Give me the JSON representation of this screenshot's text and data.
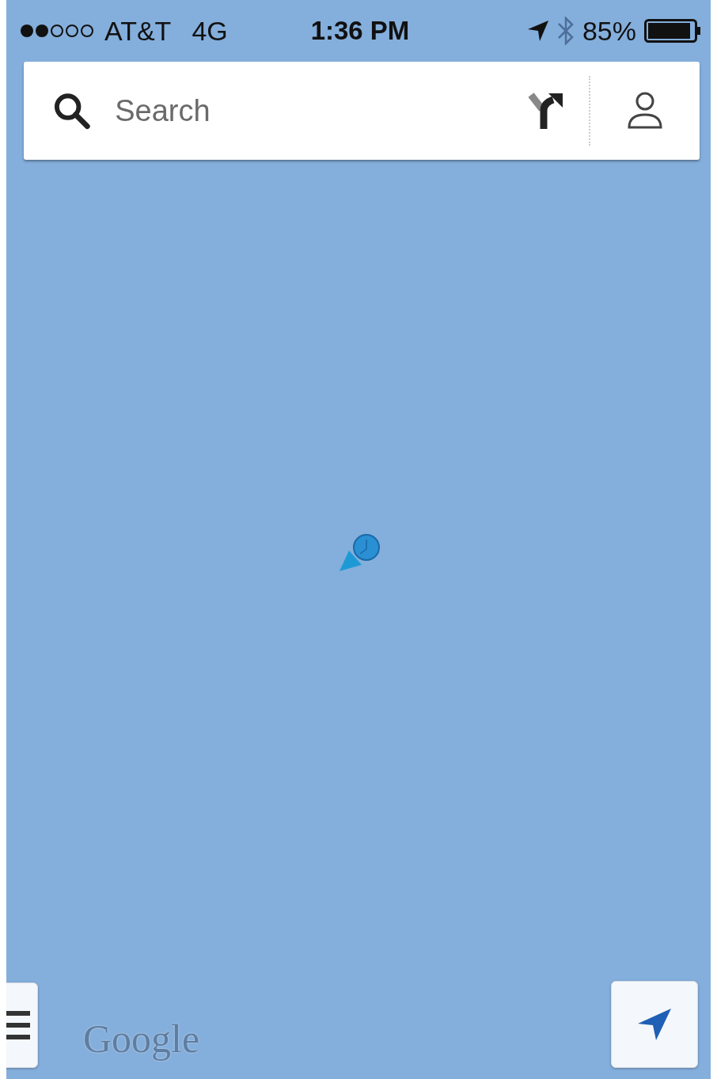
{
  "status_bar": {
    "carrier": "AT&T",
    "network": "4G",
    "time": "1:36 PM",
    "battery": "85%"
  },
  "search": {
    "placeholder": "Search"
  },
  "map": {
    "attribution": "Google"
  }
}
